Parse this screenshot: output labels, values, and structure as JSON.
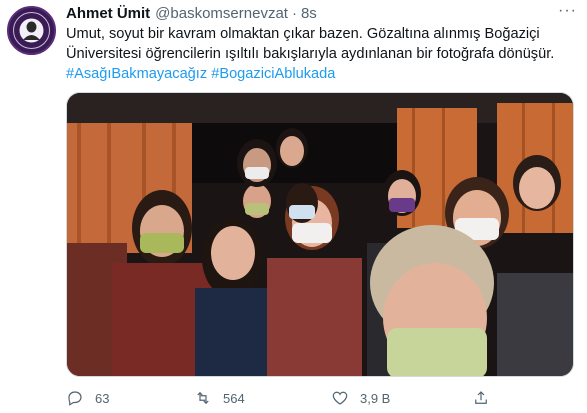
{
  "tweet": {
    "author_name": "Ahmet Ümit",
    "handle": "@baskomsernevzat",
    "separator": "·",
    "time": "8s",
    "more": "···",
    "text_line": "Umut, soyut bir kavram olmaktan çıkar bazen. Gözaltına alınmış Boğaziçi Üniversitesi öğrencilerin ışıltılı bakışlarıyla aydınlanan bir fotoğrafa dönüşür.",
    "hashtag_1": "#AsağıBakmayacağız",
    "hashtag_2": "#BogaziciAblukada"
  },
  "actions": {
    "reply_count": "63",
    "retweet_count": "564",
    "like_count": "3,9 B"
  },
  "colors": {
    "accent": "#1d9bf0",
    "muted": "#536471",
    "text": "#0f1419"
  },
  "icons": {
    "more": "more-dots-icon",
    "reply": "reply-bubble-icon",
    "retweet": "retweet-arrows-icon",
    "like": "heart-icon",
    "share": "share-upload-icon"
  }
}
